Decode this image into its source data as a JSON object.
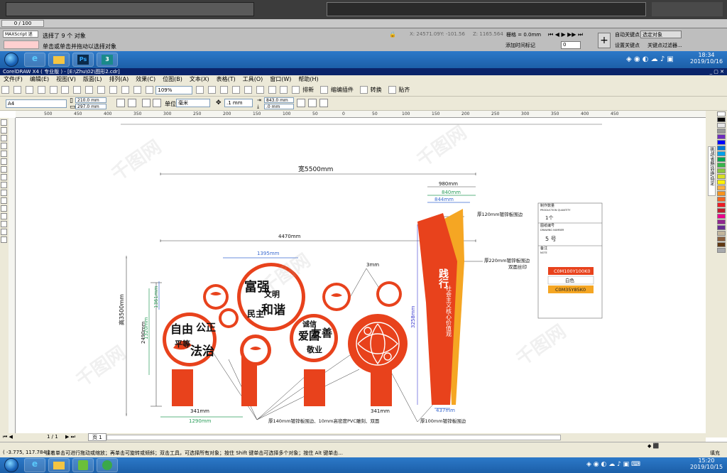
{
  "max": {
    "counter": "0 / 100",
    "script_label": "MAXScript 迷",
    "status_line1": "选择了 9 个 对象",
    "status_line2": "单击或单击并拖动以选择对象",
    "coord_x": "24571.09",
    "coord_y": "-101.56",
    "coord_z": "1165.564",
    "grid_label": "栅格 = 0.0mm",
    "add_time_tag": "添加时间标记",
    "auto_key": "自动关键点",
    "selected_label": "选定对象",
    "set_key": "设置关键点",
    "key_filter": "关键点过滤器...",
    "frame_value": "0"
  },
  "taskbar_top": {
    "time": "18:34",
    "date": "2019/10/16",
    "apps": [
      "start",
      "ie",
      "explorer",
      "photoshop",
      "3dsmax"
    ]
  },
  "coreldraw": {
    "title": "CorelDRAW X4 ( 专业版 ) - [E:\\Zhu\\02\\图形2.cdr]",
    "menu": [
      "文件(F)",
      "编辑(E)",
      "视图(V)",
      "版面(L)",
      "排列(A)",
      "效果(C)",
      "位图(B)",
      "文本(X)",
      "表格(T)",
      "工具(O)",
      "窗口(W)",
      "帮助(H)"
    ],
    "zoom": "109%",
    "toolbar_labels": [
      "排新",
      "缩编插件",
      "转换",
      "贴齐"
    ],
    "page_size": "A4",
    "width": "210.0 mm",
    "height": "297.0 mm",
    "units_label": "单位:",
    "units": "毫米",
    "nudge": ".1 mm",
    "dup_x": "843.0 mm",
    "dup_y": ".0 mm",
    "page_counter": "1 / 1",
    "page_tab": "页 1",
    "cursor_coords": "( -3.775, 117.784 )",
    "status_hint": "接着单击可进行拖动或缩放；再单击可旋转或倾斜；双击工具，可选择所有对象；按住 Shift 键单击可选择多个对象；按住 Alt 键单击...",
    "fill_label": "填充",
    "docker_tab": "挑战/省略/转换/特定",
    "ruler_ticks": [
      "500",
      "450",
      "400",
      "350",
      "300",
      "250",
      "200",
      "150",
      "100",
      "50",
      "0",
      "50",
      "100",
      "150",
      "200",
      "250",
      "300",
      "350",
      "400",
      "450"
    ],
    "palette": [
      "#ffffff",
      "#000000",
      "#e6e6e6",
      "#999999",
      "#6f2dbd",
      "#0000ff",
      "#0078d7",
      "#00a0e9",
      "#00a651",
      "#39b54a",
      "#8dc63f",
      "#d7df23",
      "#fff200",
      "#fbb040",
      "#f7941d",
      "#f26522",
      "#ed1c24",
      "#be1e2d",
      "#ec008c",
      "#92278f",
      "#662d91",
      "#c2b59b",
      "#8b5e3c",
      "#603913",
      "#a7a9ac"
    ]
  },
  "drawing": {
    "width_total": "宽5500mm",
    "width_inner": "4470mm",
    "height_total": "高3500mm",
    "height_2490": "2490mm",
    "height_1320": "1320mm",
    "height_1361": "1361mm",
    "width_1395": "1395mm",
    "gap_3mm": "3mm",
    "height_3258": "3258mm",
    "base_341a": "341mm",
    "base_1290": "1290mm",
    "base_341b": "341mm",
    "col_980": "980mm",
    "col_840": "840mm",
    "col_844": "844mm",
    "col_437": "437mm",
    "note_120": "厚120mm镀锌板围边",
    "note_220": "厚220mm镀锌板围边",
    "note_220b": "双面丝印",
    "note_140": "厚140mm镀锌板围边、10mm高密度PVC雕刻、双面",
    "note_100": "厚100mm镀锌板围边",
    "calli": [
      "富强",
      "民主",
      "文明",
      "和谐",
      "自由",
      "平等",
      "公正",
      "法治",
      "爱国",
      "敬业",
      "诚信",
      "友善"
    ],
    "pillar_title": "践行",
    "pillar_text": "社会主义核心价值观",
    "info_rows": [
      {
        "label": "制作数量",
        "sub": "PRODUCTION QUANTITY",
        "value": "1个"
      },
      {
        "label": "图纸编号",
        "sub": "DRAWING NUMBER",
        "value": "5 号"
      },
      {
        "label": "备注",
        "sub": "NOTE",
        "value": ""
      }
    ],
    "color_specs": [
      "C0M100Y100K0",
      "白色",
      "C0M35Y85K0"
    ],
    "colors": {
      "red": "#e8421c",
      "orange": "#f5a623",
      "white": "#ffffff"
    }
  },
  "taskbar_bottom": {
    "time": "15:20",
    "date": "2019/10/15"
  }
}
